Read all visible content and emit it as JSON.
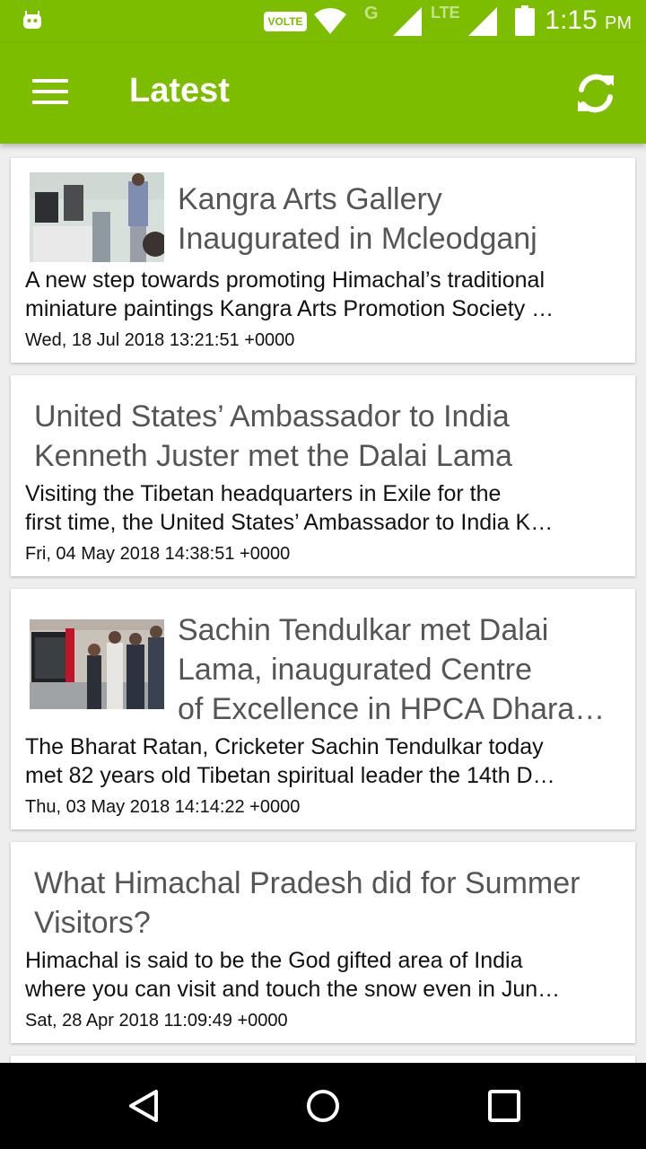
{
  "status_bar": {
    "volte": "VOLTE",
    "g_label": "G",
    "lte_label": "LTE",
    "time": "1:15",
    "ampm": "PM"
  },
  "app_bar": {
    "title": "Latest",
    "menu_icon": "hamburger-menu-icon",
    "refresh_icon": "refresh-icon",
    "color": "#7cbd00"
  },
  "articles": [
    {
      "title_line1": "Kangra Arts Gallery",
      "title_line2": "Inaugurated in Mcleodganj",
      "summary_line1": "A new step towards promoting Himachal’s traditional",
      "summary_line2": "miniature paintings  Kangra Arts Promotion Society …",
      "date": "Wed, 18 Jul 2018 13:21:51 +0000",
      "has_image": true
    },
    {
      "title_line1": "United States’ Ambassador to India",
      "title_line2": "Kenneth Juster met the Dalai Lama",
      "summary_line1": "Visiting the Tibetan headquarters in Exile for the",
      "summary_line2": "first time, the United States’ Ambassador to India K…",
      "date": "Fri, 04 May 2018 14:38:51 +0000",
      "has_image": false
    },
    {
      "title_line1": "Sachin Tendulkar met Dalai",
      "title_line2": "Lama, inaugurated Centre",
      "title_line3": "of Excellence in HPCA Dhara…",
      "summary_line1": "The Bharat Ratan, Cricketer Sachin Tendulkar today",
      "summary_line2": "met 82 years old Tibetan spiritual leader the 14th D…",
      "date": "Thu, 03 May 2018 14:14:22 +0000",
      "has_image": true
    },
    {
      "title_line1": "What Himachal Pradesh did for Summer",
      "title_line2": "Visitors?",
      "summary_line1": "Himachal is said to be the God gifted area of India",
      "summary_line2": "where you can visit and touch the snow even in Jun…",
      "date": "Sat, 28 Apr 2018 11:09:49 +0000",
      "has_image": false
    }
  ],
  "nav_bar": {
    "back_icon": "back-triangle-icon",
    "home_icon": "home-circle-icon",
    "recents_icon": "recents-square-icon"
  }
}
